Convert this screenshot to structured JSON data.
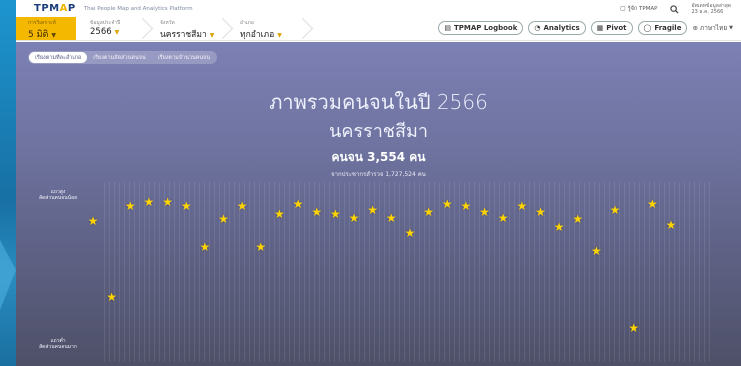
{
  "brand": {
    "logo_main": "TPM",
    "logo_a": "A",
    "logo_tail": "P",
    "tagline": "Thai People Map and Analytics Platform",
    "about": "รู้จัก TPMAP",
    "update_label": "อัพเดทข้อมูลล่าสุด",
    "update_date": "23 ธ.ค. 2566"
  },
  "filters": {
    "year_type": {
      "label": "การวิเคราะห์",
      "value": "5 มิติ"
    },
    "year": {
      "label": "ข้อมูลประจำปี",
      "value": "2566"
    },
    "province": {
      "label": "จังหวัด",
      "value": "นครราชสีมา"
    },
    "district": {
      "label": "อำเภอ",
      "value": "ทุกอำเภอ"
    }
  },
  "toolbar": {
    "logbook": "TPMAP Logbook",
    "analytics": "Analytics",
    "pivot": "Pivot",
    "fragile": "Fragile",
    "lang": "ภาษาไทย"
  },
  "tabs": [
    {
      "label": "เรียงตามทีละอำเภอ",
      "active": true
    },
    {
      "label": "เรียงตามสัดส่วนคนจน",
      "active": false
    },
    {
      "label": "เรียงตามจำนวนคนจน",
      "active": false
    }
  ],
  "summary": {
    "title_line1": "ภาพรวมคนจนในปี 2566",
    "title_line2": "นครราชสีมา",
    "poor_count": "คนจน 3,554 คน",
    "population": "จากประชากรสำรวจ 1,727,524 คน"
  },
  "axis": {
    "top_label_1": "แถวสูง",
    "top_label_2": "สัดส่วนคนจนน้อย",
    "bottom_label_1": "แถวต่ำ",
    "bottom_label_2": "สัดส่วนคนจนมาก"
  },
  "star_levels": [
    0.77,
    0.38,
    0.85,
    0.87,
    0.87,
    0.85,
    0.64,
    0.78,
    0.85,
    0.64,
    0.81,
    0.86,
    0.82,
    0.81,
    0.79,
    0.83,
    0.79,
    0.71,
    0.82,
    0.86,
    0.85,
    0.82,
    0.79,
    0.85,
    0.82,
    0.74,
    0.78,
    0.62,
    0.83,
    0.22,
    0.86,
    0.75
  ],
  "colors": {
    "accent": "#f5b800",
    "star": "#ffd400",
    "panel_top": "#7c80b4",
    "panel_bottom": "#4e5068"
  }
}
